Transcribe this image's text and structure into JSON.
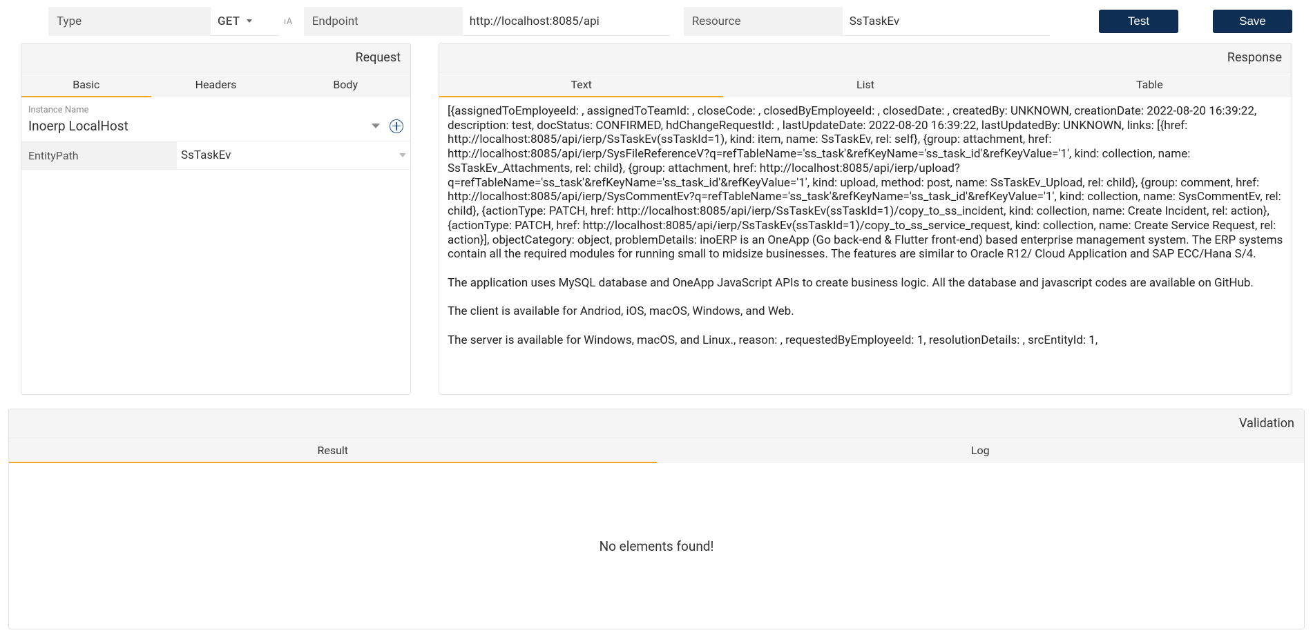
{
  "topbar": {
    "type_label": "Type",
    "method": "GET",
    "endpoint_label": "Endpoint",
    "endpoint_value": "http://localhost:8085/api",
    "resource_label": "Resource",
    "resource_value": "SsTaskEv",
    "test_btn": "Test",
    "save_btn": "Save"
  },
  "request": {
    "title": "Request",
    "tabs": {
      "basic": "Basic",
      "headers": "Headers",
      "body": "Body"
    },
    "instance_label": "Instance Name",
    "instance_value": "Inoerp LocalHost",
    "entity_label": "EntityPath",
    "entity_value": "SsTaskEv"
  },
  "response": {
    "title": "Response",
    "tabs": {
      "text": "Text",
      "list": "List",
      "table": "Table"
    },
    "text_body": "[{assignedToEmployeeId: , assignedToTeamId: , closeCode: , closedByEmployeeId: , closedDate: , createdBy: UNKNOWN, creationDate: 2022-08-20 16:39:22, description: test, docStatus: CONFIRMED, hdChangeRequestId: , lastUpdateDate: 2022-08-20 16:39:22, lastUpdatedBy: UNKNOWN, links: [{href: http://localhost:8085/api/ierp/SsTaskEv(ssTaskId=1), kind: item, name: SsTaskEv, rel: self}, {group: attachment, href: http://localhost:8085/api/ierp/SysFileReferenceV?q=refTableName='ss_task'&refKeyName='ss_task_id'&refKeyValue='1', kind: collection, name: SsTaskEv_Attachments, rel: child}, {group: attachment, href: http://localhost:8085/api/ierp/upload?q=refTableName='ss_task'&refKeyName='ss_task_id'&refKeyValue='1', kind: upload, method: post, name: SsTaskEv_Upload, rel: child}, {group: comment, href: http://localhost:8085/api/ierp/SysCommentEv?q=refTableName='ss_task'&refKeyName='ss_task_id'&refKeyValue='1', kind: collection, name: SysCommentEv, rel: child}, {actionType: PATCH, href: http://localhost:8085/api/ierp/SsTaskEv(ssTaskId=1)/copy_to_ss_incident, kind: collection, name: Create Incident, rel: action}, {actionType: PATCH, href: http://localhost:8085/api/ierp/SsTaskEv(ssTaskId=1)/copy_to_ss_service_request, kind: collection, name: Create Service Request, rel: action}], objectCategory: object, problemDetails: inoERP is an OneApp (Go back-end & Flutter front-end) based enterprise management system. The ERP systems contain all the required modules for running small to midsize businesses. The features are similar to Oracle R12/ Cloud Application and SAP ECC/Hana S/4.\n\nThe application uses MySQL database and OneApp JavaScript APIs to create business logic. All the database and javascript codes are available on GitHub.\n\nThe client is available for Andriod, iOS, macOS, Windows, and Web.\n\nThe server is available for Windows, macOS, and Linux., reason: , requestedByEmployeeId: 1, resolutionDetails: , srcEntityId: 1,"
  },
  "validation": {
    "title": "Validation",
    "tabs": {
      "result": "Result",
      "log": "Log"
    },
    "empty": "No elements found!"
  }
}
